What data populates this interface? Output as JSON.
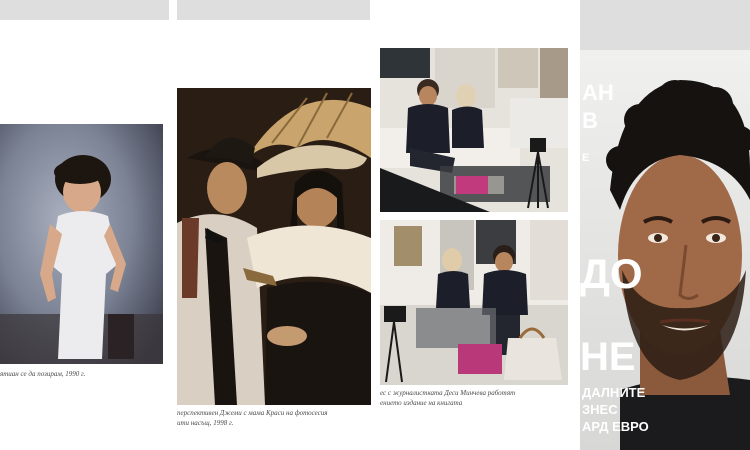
{
  "pages": {
    "left": {
      "caption": "ятиан се да позирам, 1990 г."
    },
    "middle": {
      "caption_line1": "перспективен Джеми с мама Краси на фотосесия",
      "caption_line2": "ити насъщ, 1998 г."
    },
    "right": {
      "caption_line1": "ес с журналистката Деси Минчева работят",
      "caption_line2": "ението издание на книгата"
    }
  },
  "cover": {
    "title_fragments": [
      "АН",
      "В",
      "ДО",
      "НЕ"
    ],
    "side_letter": "Е",
    "subtitle_lines": [
      "ДАЛНИТЕ",
      "ЗНЕС",
      "АРД ЕВРО"
    ]
  },
  "colors": {
    "topbar": "#dedede",
    "sepia_bg": "#2a1e14",
    "cover_bg": "#e6e6e6"
  }
}
